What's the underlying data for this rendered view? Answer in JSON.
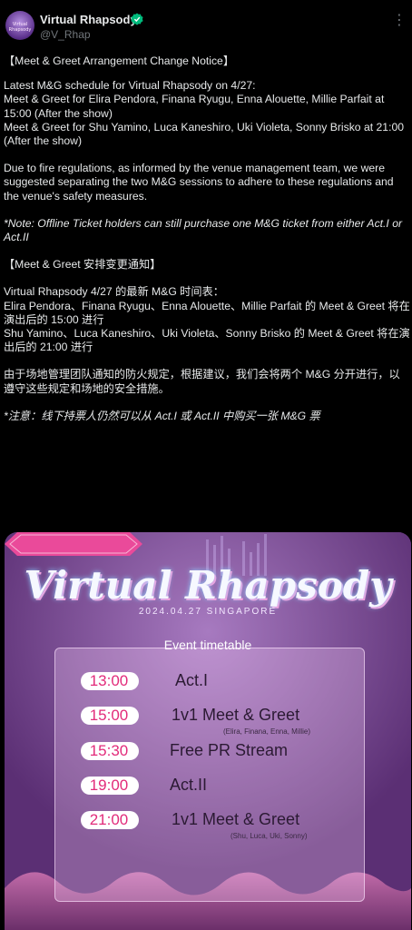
{
  "account": {
    "name": "Virtual Rhapsody",
    "handle": "@V_Rhap",
    "avatar_text": "Virtual Rhapsody"
  },
  "tweet": {
    "lines": [
      "【Meet & Greet Arrangement Change Notice】",
      "Latest M&G schedule for Virtual Rhapsody on 4/27:",
      "Meet & Greet for Elira Pendora, Finana Ryugu, Enna Alouette, Millie Parfait at 15:00 (After the show)",
      "Meet & Greet for Shu Yamino, Luca Kaneshiro, Uki Violeta, Sonny Brisko at 21:00 (After the show)",
      "Due to fire regulations, as informed by the venue management team, we were suggested separating the two M&G sessions to adhere to these regulations and the venue's safety measures.",
      "*Note: Offline Ticket holders can still purchase one M&G ticket from either Act.I or Act.II",
      "【Meet & Greet 安排变更通知】",
      "Virtual Rhapsody 4/27 的最新 M&G 时间表：",
      "Elira Pendora、Finana Ryugu、Enna Alouette、Millie Parfait 的 Meet & Greet 将在演出后的 15:00 进行",
      "Shu Yamino、Luca Kaneshiro、Uki Violeta、Sonny Brisko 的 Meet & Greet 将在演出后的 21:00 进行",
      "由于场地管理团队通知的防火规定，根据建议，我们会将两个 M&G 分开进行，以遵守这些规定和场地的安全措施。",
      "*注意：线下持票人仍然可以从 Act.I 或 Act.II 中购买一张 M&G 票"
    ]
  },
  "poster": {
    "logo": "Virtual Rhapsody",
    "date_location": "2024.04.27 SINGAPORE",
    "ribbon": "Event timetable",
    "schedule": [
      {
        "time": "13:00",
        "event": "Act.I",
        "note": ""
      },
      {
        "time": "15:00",
        "event": "1v1 Meet & Greet",
        "note": "(Elira, Finana, Enna, Millie)"
      },
      {
        "time": "15:30",
        "event": "Free PR Stream",
        "note": ""
      },
      {
        "time": "19:00",
        "event": "Act.II",
        "note": ""
      },
      {
        "time": "21:00",
        "event": "1v1 Meet & Greet",
        "note": "(Shu, Luca, Uki, Sonny)"
      }
    ]
  },
  "colors": {
    "verified": "#00ba7c",
    "time_pink": "#e22b7a",
    "ribbon": "#ea4a9a",
    "card_purple": "#6b3f83"
  },
  "icons": [
    "verified-badge-icon",
    "more-options-icon"
  ]
}
